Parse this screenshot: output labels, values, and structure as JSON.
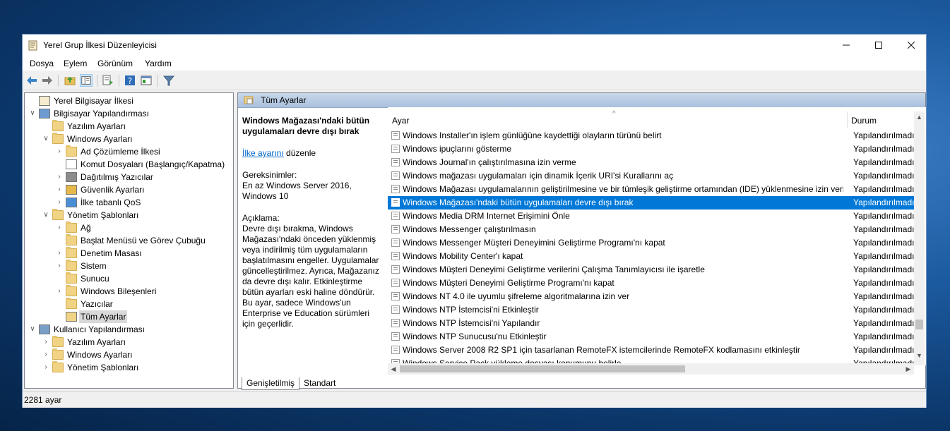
{
  "window": {
    "title": "Yerel Grup İlkesi Düzenleyicisi"
  },
  "menu": [
    "Dosya",
    "Eylem",
    "Görünüm",
    "Yardım"
  ],
  "tree": {
    "items": [
      {
        "label": "Yerel Bilgisayar İlkesi",
        "level": 0,
        "expander": "",
        "icon": "policy-icon"
      },
      {
        "label": "Bilgisayar Yapılandırması",
        "level": 0,
        "expander": "v",
        "icon": "computer-icon"
      },
      {
        "label": "Yazılım Ayarları",
        "level": 1,
        "expander": "",
        "icon": "folder-icon"
      },
      {
        "label": "Windows Ayarları",
        "level": 1,
        "expander": "v",
        "icon": "folder-icon"
      },
      {
        "label": "Ad Çözümleme İlkesi",
        "level": 2,
        "expander": ">",
        "icon": "folder-icon"
      },
      {
        "label": "Komut Dosyaları (Başlangıç/Kapatma)",
        "level": 2,
        "expander": "",
        "icon": "script-icon"
      },
      {
        "label": "Dağıtılmış Yazıcılar",
        "level": 2,
        "expander": ">",
        "icon": "printer-icon"
      },
      {
        "label": "Güvenlik Ayarları",
        "level": 2,
        "expander": ">",
        "icon": "security-icon"
      },
      {
        "label": "İlke tabanlı QoS",
        "level": 2,
        "expander": ">",
        "icon": "chart-icon"
      },
      {
        "label": "Yönetim Şablonları",
        "level": 1,
        "expander": "v",
        "icon": "folder-icon"
      },
      {
        "label": "Ağ",
        "level": 2,
        "expander": ">",
        "icon": "folder-icon"
      },
      {
        "label": "Başlat Menüsü ve Görev Çubuğu",
        "level": 2,
        "expander": "",
        "icon": "folder-icon"
      },
      {
        "label": "Denetim Masası",
        "level": 2,
        "expander": ">",
        "icon": "folder-icon"
      },
      {
        "label": "Sistem",
        "level": 2,
        "expander": ">",
        "icon": "folder-icon"
      },
      {
        "label": "Sunucu",
        "level": 2,
        "expander": "",
        "icon": "folder-icon"
      },
      {
        "label": "Windows Bileşenleri",
        "level": 2,
        "expander": ">",
        "icon": "folder-icon"
      },
      {
        "label": "Yazıcılar",
        "level": 2,
        "expander": "",
        "icon": "folder-icon"
      },
      {
        "label": "Tüm Ayarlar",
        "level": 2,
        "expander": "",
        "icon": "all-settings-icon",
        "selected": true
      },
      {
        "label": "Kullanıcı Yapılandırması",
        "level": 0,
        "expander": "v",
        "icon": "user-icon"
      },
      {
        "label": "Yazılım Ayarları",
        "level": 1,
        "expander": ">",
        "icon": "folder-icon"
      },
      {
        "label": "Windows Ayarları",
        "level": 1,
        "expander": ">",
        "icon": "folder-icon"
      },
      {
        "label": "Yönetim Şablonları",
        "level": 1,
        "expander": ">",
        "icon": "folder-icon"
      }
    ]
  },
  "panel": {
    "header": "Tüm Ayarlar",
    "desc_title": "Windows Mağazası'ndaki bütün uygulamaları devre dışı bırak",
    "edit_link": "İlke ayarını",
    "edit_suffix": " düzenle",
    "req_label": "Gereksinimler:",
    "req_value": "En az Windows Server 2016, Windows 10",
    "desc_label": "Açıklama:",
    "desc_body": "Devre dışı bırakma, Windows Mağazası'ndaki önceden yüklenmiş veya indirilmiş tüm uygulamaların başlatılmasını engeller. Uygulamalar güncelleştirilmez. Ayrıca, Mağazanız da devre dışı kalır. Etkinleştirme bütün ayarları eski haline döndürür. Bu ayar, sadece Windows'un Enterprise ve Education sürümleri için geçerlidir."
  },
  "list": {
    "col_setting": "Ayar",
    "col_state": "Durum",
    "rows": [
      {
        "setting": "Windows Installer'ın işlem günlüğüne kaydettiği olayların türünü belirt",
        "state": "Yapılandırılmadı"
      },
      {
        "setting": "Windows ipuçlarını gösterme",
        "state": "Yapılandırılmadı"
      },
      {
        "setting": "Windows Journal'ın çalıştırılmasına izin verme",
        "state": "Yapılandırılmadı"
      },
      {
        "setting": "Windows mağazası uygulamaları için dinamik İçerik URI'si Kurallarını aç",
        "state": "Yapılandırılmadı"
      },
      {
        "setting": "Windows Mağazası uygulamalarının geliştirilmesine ve bir tümleşik geliştirme ortamından (IDE) yüklenmesine izin verir",
        "state": "Yapılandırılmadı"
      },
      {
        "setting": "Windows Mağazası'ndaki bütün uygulamaları devre dışı bırak",
        "state": "Yapılandırılmadı",
        "selected": true
      },
      {
        "setting": "Windows Media DRM Internet Erişimini Önle",
        "state": "Yapılandırılmadı"
      },
      {
        "setting": "Windows Messenger çalıştırılmasın",
        "state": "Yapılandırılmadı"
      },
      {
        "setting": "Windows Messenger Müşteri Deneyimini Geliştirme Programı'nı kapat",
        "state": "Yapılandırılmadı"
      },
      {
        "setting": "Windows Mobility Center'ı kapat",
        "state": "Yapılandırılmadı"
      },
      {
        "setting": "Windows Müşteri Deneyimi Geliştirme verilerini Çalışma Tanımlayıcısı ile işaretle",
        "state": "Yapılandırılmadı"
      },
      {
        "setting": "Windows Müşteri Deneyimi Geliştirme Programı'nı kapat",
        "state": "Yapılandırılmadı"
      },
      {
        "setting": "Windows NT 4.0 ile uyumlu şifreleme algoritmalarına izin ver",
        "state": "Yapılandırılmadı"
      },
      {
        "setting": "Windows NTP İstemcisi'ni Etkinleştir",
        "state": "Yapılandırılmadı"
      },
      {
        "setting": "Windows NTP İstemcisi'ni Yapılandır",
        "state": "Yapılandırılmadı"
      },
      {
        "setting": "Windows NTP Sunucusu'nu Etkinleştir",
        "state": "Yapılandırılmadı"
      },
      {
        "setting": "Windows Server 2008 R2 SP1 için tasarlanan RemoteFX istemcilerinde RemoteFX kodlamasını etkinleştir",
        "state": "Yapılandırılmadı"
      },
      {
        "setting": "Windows Service Pack yükleme dosyası konumunu belirle",
        "state": "Yapılandırılmadı"
      }
    ]
  },
  "tabs": [
    "Genişletilmiş",
    "Standart"
  ],
  "status": {
    "count": "2281 ayar"
  }
}
